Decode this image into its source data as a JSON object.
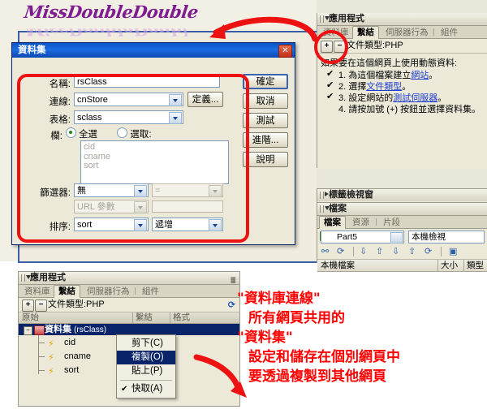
{
  "watermark": {
    "text": "MissDoubleDouble"
  },
  "dialog": {
    "title": "資料集",
    "close_label": "✕",
    "fields": {
      "name_label": "名稱:",
      "name_value": "rsClass",
      "connection_label": "連線:",
      "connection_value": "cnStore",
      "define_button": "定義...",
      "table_label": "表格:",
      "table_value": "sclass",
      "columns_label": "欄:",
      "radio_all": "全選",
      "radio_selected": "選取:",
      "column_items": [
        "cid",
        "cname",
        "sort"
      ],
      "filter_label": "篩選器:",
      "filter_value": "無",
      "filter_op_value": "=",
      "filter_param_value": "URL 參數",
      "filter_param_text": "",
      "sort_label": "排序:",
      "sort_value": "sort",
      "sort_dir_value": "遞增"
    },
    "buttons": {
      "ok": "確定",
      "cancel": "取消",
      "test": "測試",
      "advanced": "進階...",
      "help": "說明"
    }
  },
  "app_panel": {
    "title": "應用程式",
    "menu_icon": "≣",
    "tabs": [
      {
        "label": "資料庫",
        "active": false
      },
      {
        "label": "繫結",
        "active": true
      },
      {
        "label": "伺服器行為",
        "active": false
      },
      {
        "label": "組件",
        "active": false
      }
    ],
    "plus_button": "+",
    "minus_button": "−",
    "doctype_label": "文件類型:PHP",
    "hint_title": "如果要在這個網頁上使用動態資料:",
    "steps": [
      {
        "checked": true,
        "text_before": "1. 為這個檔案建立",
        "link": "網站",
        "text_after": "。"
      },
      {
        "checked": true,
        "text_before": "2. 選擇",
        "link": "文件類型",
        "text_after": "。"
      },
      {
        "checked": true,
        "text_before": "3. 設定網站的",
        "link": "測試伺服器",
        "text_after": "。"
      },
      {
        "checked": false,
        "text_before": "4. 請按加號 (+) 按鈕並選擇資料集。",
        "link": "",
        "text_after": ""
      }
    ],
    "check_glyph": "✔"
  },
  "tag_panel": {
    "title": "標籤檢視窗"
  },
  "files_panel": {
    "title": "檔案",
    "tabs": [
      {
        "label": "檔案",
        "active": true
      },
      {
        "label": "資源",
        "active": false
      },
      {
        "label": "片段",
        "active": false
      }
    ],
    "site_value": "Part5",
    "view_value": "本機檢視",
    "toolbar_icons": [
      "connect-icon",
      "refresh-icon",
      "get-icon",
      "put-icon",
      "check-out-icon",
      "check-in-icon",
      "sync-icon",
      "expand-icon"
    ],
    "columns": [
      "本機檔案",
      "大小",
      "類型"
    ]
  },
  "bottom_panel": {
    "title": "應用程式",
    "menu_icon": "≣",
    "tabs": [
      {
        "label": "資料庫",
        "active": false
      },
      {
        "label": "繫結",
        "active": true
      },
      {
        "label": "伺服器行為",
        "active": false
      },
      {
        "label": "組件",
        "active": false
      }
    ],
    "plus_button": "+",
    "minus_button": "−",
    "doctype_label": "文件類型:PHP",
    "refresh_icon": "⟳",
    "tree_columns": [
      "原始",
      "繫結",
      "格式"
    ],
    "recordset_row": {
      "expander": "−",
      "label": "資料集",
      "detail": "(rsClass)"
    },
    "fields": [
      "cid",
      "cname",
      "sort"
    ]
  },
  "context_menu": {
    "items": [
      {
        "label": "剪下(C)",
        "selected": false,
        "checked": false
      },
      {
        "label": "複製(O)",
        "selected": true,
        "checked": false
      },
      {
        "label": "貼上(P)",
        "selected": false,
        "checked": false
      },
      {
        "label": "快取(A)",
        "selected": false,
        "checked": true
      }
    ],
    "check_glyph": "✔"
  },
  "annotation": {
    "line1": "\"資料庫連線\"",
    "line2": "所有網頁共用的",
    "line3": "\"資料集\"",
    "line4": "設定和儲存在個別網頁中",
    "line5": "要透過複製到其他網頁"
  },
  "colors": {
    "accent_red": "#ff0000",
    "title_blue": "#0a55c8",
    "select_blue": "#0a246a",
    "panel_bg": "#ece9d8",
    "link_blue": "#1d3fd0"
  }
}
